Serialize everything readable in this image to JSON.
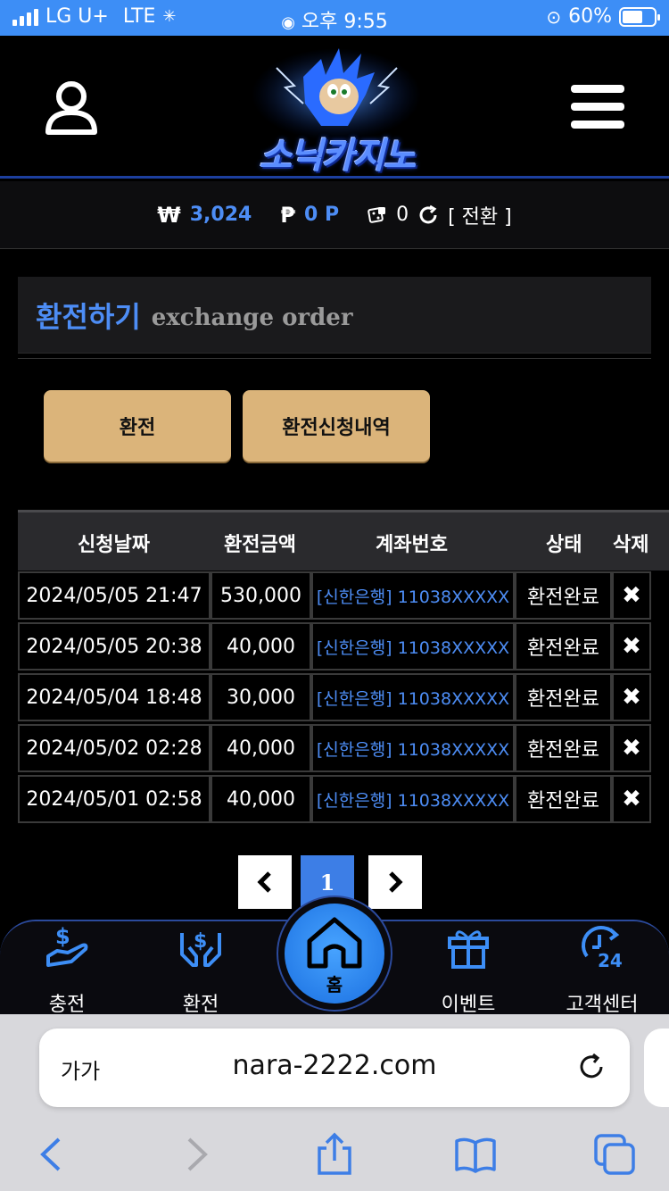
{
  "status_bar": {
    "carrier": "LG U+",
    "network": "LTE",
    "time": "오후 9:55",
    "battery": "60%"
  },
  "header": {
    "logo_text": "소닉카지노"
  },
  "balance": {
    "won_symbol": "₩",
    "won_value": "3,024",
    "point_symbol": "₱",
    "point_value": "0 P",
    "chip_value": "0",
    "convert_label": "[ 전환 ]"
  },
  "section": {
    "title_ko": "환전하기",
    "title_en": "exchange order"
  },
  "buttons": {
    "exchange": "환전",
    "history": "환전신청내역"
  },
  "table": {
    "headers": [
      "신청날짜",
      "환전금액",
      "계좌번호",
      "상태",
      "삭제"
    ],
    "rows": [
      {
        "date": "2024/05/05 21:47",
        "amount": "530,000",
        "account": "[신한은행] 11038XXXXX",
        "status": "환전완료",
        "delete": "✖"
      },
      {
        "date": "2024/05/05 20:38",
        "amount": "40,000",
        "account": "[신한은행] 11038XXXXX",
        "status": "환전완료",
        "delete": "✖"
      },
      {
        "date": "2024/05/04 18:48",
        "amount": "30,000",
        "account": "[신한은행] 11038XXXXX",
        "status": "환전완료",
        "delete": "✖"
      },
      {
        "date": "2024/05/02 02:28",
        "amount": "40,000",
        "account": "[신한은행] 11038XXXXX",
        "status": "환전완료",
        "delete": "✖"
      },
      {
        "date": "2024/05/01 02:58",
        "amount": "40,000",
        "account": "[신한은행] 11038XXXXX",
        "status": "환전완료",
        "delete": "✖"
      }
    ]
  },
  "pagination": {
    "prev": "‹",
    "current": "1",
    "next": "›"
  },
  "bottom_nav": {
    "charge": "충전",
    "exchange": "환전",
    "home": "홈",
    "event": "이벤트",
    "support": "고객센터",
    "support_badge": "24"
  },
  "browser": {
    "text_size": "가가",
    "url": "nara-2222.com"
  },
  "colors": {
    "accent_blue": "#4d8df5",
    "button_gold": "#dbb47a",
    "status_bar": "#3d8ef6"
  }
}
